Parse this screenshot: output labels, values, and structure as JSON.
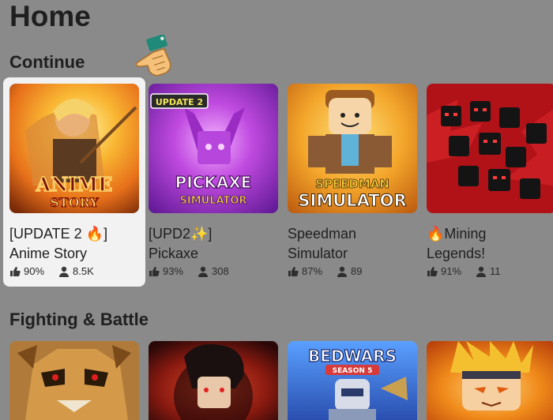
{
  "page": {
    "title": "Home"
  },
  "sections": [
    {
      "title": "Continue",
      "games": [
        {
          "title_line1": "[UPDATE 2 🔥]",
          "title_line2": "Anime Story",
          "rating": "90%",
          "players": "8.5K",
          "thumb_text": "ANIME STORY",
          "accent": "#f39a1c"
        },
        {
          "title_line1": "[UPD2✨]",
          "title_line2": "Pickaxe",
          "rating": "93%",
          "players": "308",
          "thumb_text": "PICKAXE SIMULATOR",
          "badge": "UPDATE 2",
          "accent": "#b33bd6"
        },
        {
          "title_line1": "Speedman",
          "title_line2": "Simulator",
          "rating": "87%",
          "players": "89",
          "thumb_text": "SPEEDMAN SIMULATOR",
          "accent": "#f0a020"
        },
        {
          "title_line1": "🔥Mining",
          "title_line2": "Legends!",
          "rating": "91%",
          "players": "11",
          "thumb_text": "",
          "accent": "#c8151b"
        }
      ]
    },
    {
      "title": "Fighting & Battle",
      "games": [
        {
          "thumb_text": "",
          "accent": "#c98a3a"
        },
        {
          "thumb_text": "",
          "accent": "#a52a1a"
        },
        {
          "thumb_text": "BEDWARS SEASON 5",
          "accent": "#3a6fd8"
        },
        {
          "thumb_text": "",
          "accent": "#e07a1a"
        }
      ]
    }
  ]
}
